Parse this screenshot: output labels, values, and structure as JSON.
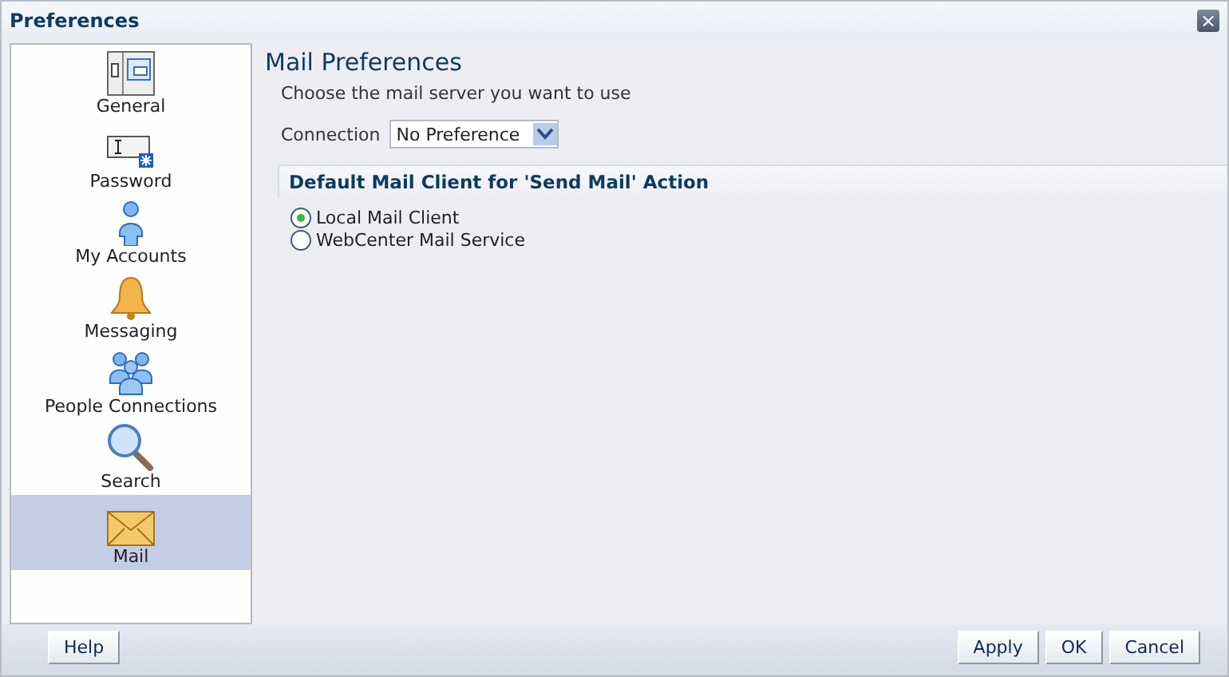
{
  "window": {
    "title": "Preferences",
    "close": "×"
  },
  "sidebar": {
    "items": [
      {
        "label": "General",
        "kind": "general",
        "selected": false
      },
      {
        "label": "Password",
        "kind": "password",
        "selected": false
      },
      {
        "label": "My Accounts",
        "kind": "accounts",
        "selected": false
      },
      {
        "label": "Messaging",
        "kind": "messaging",
        "selected": false
      },
      {
        "label": "People Connections",
        "kind": "people",
        "selected": false
      },
      {
        "label": "Search",
        "kind": "search",
        "selected": false
      },
      {
        "label": "Mail",
        "kind": "mail",
        "selected": true
      }
    ]
  },
  "content": {
    "title": "Mail Preferences",
    "description": "Choose the mail server you want to use",
    "connection": {
      "label": "Connection",
      "value": "No Preference"
    },
    "section": {
      "title": "Default Mail Client for 'Send Mail' Action",
      "options": [
        {
          "label": "Local Mail Client",
          "selected": true
        },
        {
          "label": "WebCenter Mail Service",
          "selected": false
        }
      ]
    }
  },
  "footer": {
    "help": "Help",
    "buttons": [
      "Apply",
      "OK",
      "Cancel"
    ]
  }
}
